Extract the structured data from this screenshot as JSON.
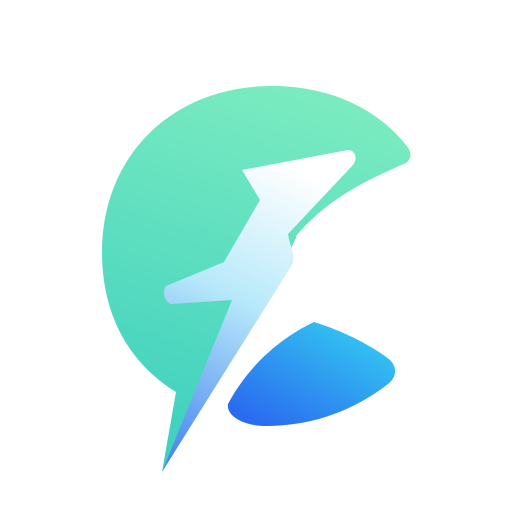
{
  "app_icon": {
    "name": "lightning-chat-logo",
    "background_color": "#ffffff",
    "colors": {
      "bubble_top": "#7AEBC0",
      "bubble_bottom": "#3CCFC0",
      "bolt_top": "#FFFFFF",
      "bolt_mid": "#B8E9FA",
      "bolt_bottom": "#4A86F0",
      "lower_shape_top": "#33C7F1",
      "lower_shape_bottom": "#2A6CF0"
    }
  }
}
